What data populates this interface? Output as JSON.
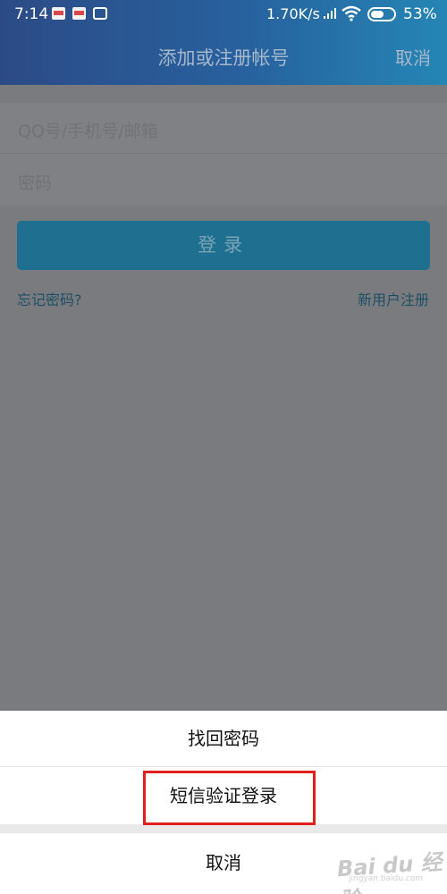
{
  "status_bar": {
    "time": "7:14",
    "speed": "1.70K/s",
    "battery": "53%",
    "icons": [
      "notification-icon",
      "notification-icon",
      "app-icon",
      "signal-icon",
      "wifi-icon",
      "battery-icon"
    ]
  },
  "header": {
    "title": "添加或注册帐号",
    "cancel": "取消"
  },
  "form": {
    "username_placeholder": "QQ号/手机号/邮箱",
    "password_placeholder": "密码",
    "login_button": "登录",
    "forgot_password": "忘记密码?",
    "register": "新用户注册"
  },
  "action_sheet": {
    "items": [
      "找回密码",
      "短信验证登录"
    ],
    "cancel": "取消"
  },
  "watermark": {
    "brand": "Bai du 经验",
    "url": "jingyan.baidu.com"
  },
  "colors": {
    "header_gradient_start": "#2c4b86",
    "header_gradient_end": "#2586b5",
    "highlight": "#e11f1f",
    "dim_overlay": "#7a7b7f"
  }
}
